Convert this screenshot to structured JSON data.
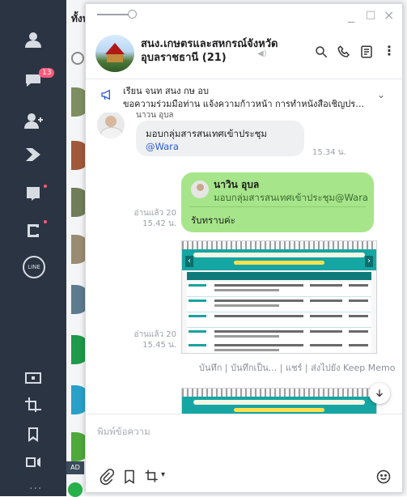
{
  "sidebar": {
    "chat_badge": "13",
    "line_label": "LINE"
  },
  "chatlist": {
    "tab_label": "ทั้งห",
    "ad_label": "AD"
  },
  "window": {
    "minimize": "_",
    "maximize": "□",
    "close": "×"
  },
  "chat_header": {
    "title": "สนง.เกษตรและสหกรณ์จังหวัดอุบลราชธานี (21)",
    "kebab": "⋮"
  },
  "announcement": {
    "line1": "เรียน จนท สนง กษ อบ",
    "line2": "ขอความร่วมมือท่าน แจ้งความก้าวหน้า การทำหนังสือเชิญประชุม"
  },
  "messages": {
    "m1": {
      "sender": "นาวิน อุบล",
      "text": "มอบกลุ่มสารสนเทศเข้าประชุม",
      "mention": "@Wara",
      "time": "15.34 น."
    },
    "m2": {
      "read": "อ่านแล้ว 20",
      "time": "15.42 น.",
      "quote_name": "นาวิน อุบล",
      "quote_text": "มอบกลุ่มสารสนเทศเข้าประชุม@Wara",
      "text": "รับทราบค่ะ"
    },
    "m3": {
      "read": "อ่านแล้ว 20",
      "time": "15.45 น.",
      "actions": "บันทึก | บันทึกเป็น... | แชร์ | ส่งไปยัง Keep Memo"
    }
  },
  "input": {
    "placeholder": "พิมพ์ข้อความ"
  }
}
